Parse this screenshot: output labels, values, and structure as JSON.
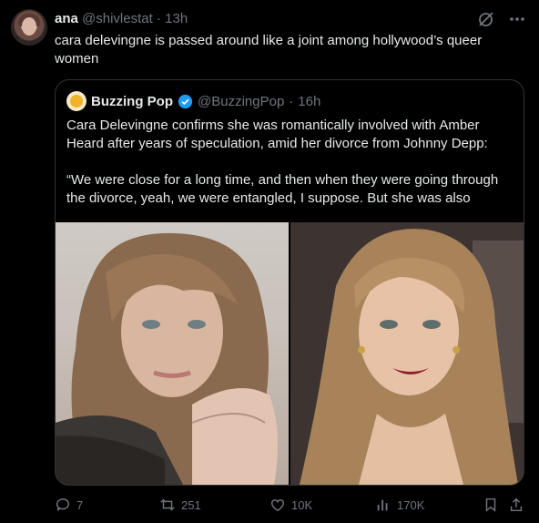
{
  "author": {
    "name": "ana",
    "handle": "@shivlestat",
    "separator": "·",
    "time": "13h"
  },
  "tweet_text": "cara delevingne is passed around like a joint among hollywood’s queer women",
  "quoted": {
    "name": "Buzzing Pop",
    "handle": "@BuzzingPop",
    "separator": "·",
    "time": "16h",
    "paragraph1": "Cara Delevingne confirms she was romantically involved with Amber Heard after years of speculation, amid her divorce from Johnny Depp:",
    "paragraph2": "“We were close for a long time, and then when they were going through the divorce, yeah, we were entangled, I suppose. But she was also"
  },
  "actions": {
    "replies": "7",
    "reposts": "251",
    "likes": "10K",
    "views": "170K"
  },
  "colors": {
    "background": "#000000",
    "text": "#e7e9ea",
    "muted": "#71767b",
    "border": "#2f3336",
    "verified": "#1d9bf0"
  }
}
